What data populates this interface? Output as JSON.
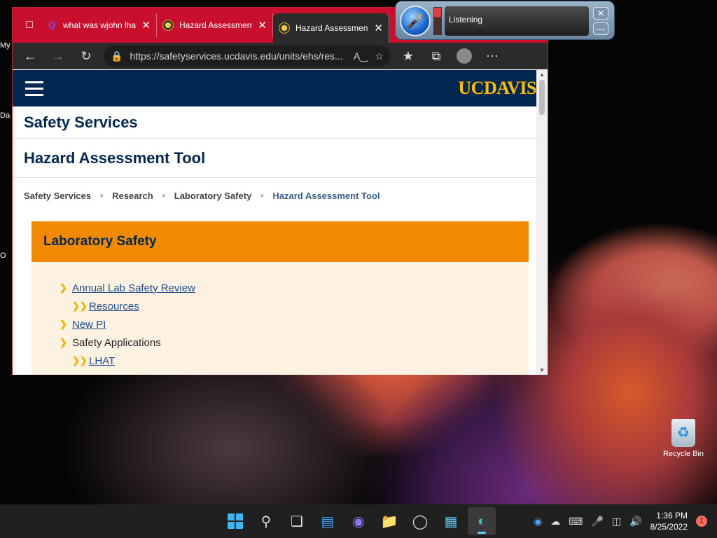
{
  "desktop": {
    "left_fragments": [
      "My",
      "Da",
      "",
      "O"
    ],
    "recycle_bin_label": "Recycle Bin"
  },
  "browser": {
    "tabs": [
      {
        "title": "what was wjohn lha",
        "favicon": "search-icon"
      },
      {
        "title": "Hazard Assessment",
        "favicon": "ucd-favicon"
      },
      {
        "title": "Hazard Assessment",
        "favicon": "ucd-favicon",
        "active": true
      }
    ],
    "address_url": "https://safetyservices.ucdavis.edu/units/ehs/res..."
  },
  "site": {
    "logo": "UCDAVIS",
    "unit_title": "Safety Services",
    "page_title": "Hazard Assessment Tool",
    "breadcrumb": [
      "Safety Services",
      "Research",
      "Laboratory Safety",
      "Hazard Assessment Tool"
    ],
    "panel_title": "Laboratory Safety",
    "items": [
      {
        "label": "Annual Lab Safety Review",
        "link": true,
        "level": 1
      },
      {
        "label": "Resources",
        "link": true,
        "level": 2
      },
      {
        "label": "New PI",
        "link": true,
        "level": 1
      },
      {
        "label": "Safety Applications",
        "link": false,
        "level": 1
      },
      {
        "label": "LHAT",
        "link": true,
        "level": 2
      }
    ]
  },
  "speech": {
    "status": "Listening"
  },
  "taskbar": {
    "time": "1:36 PM",
    "date": "8/25/2022",
    "notification_count": "1"
  },
  "colors": {
    "ucd_blue": "#022851",
    "ucd_gold": "#ffbf00",
    "panel_orange": "#f18a00",
    "tab_red": "#c8102e"
  }
}
